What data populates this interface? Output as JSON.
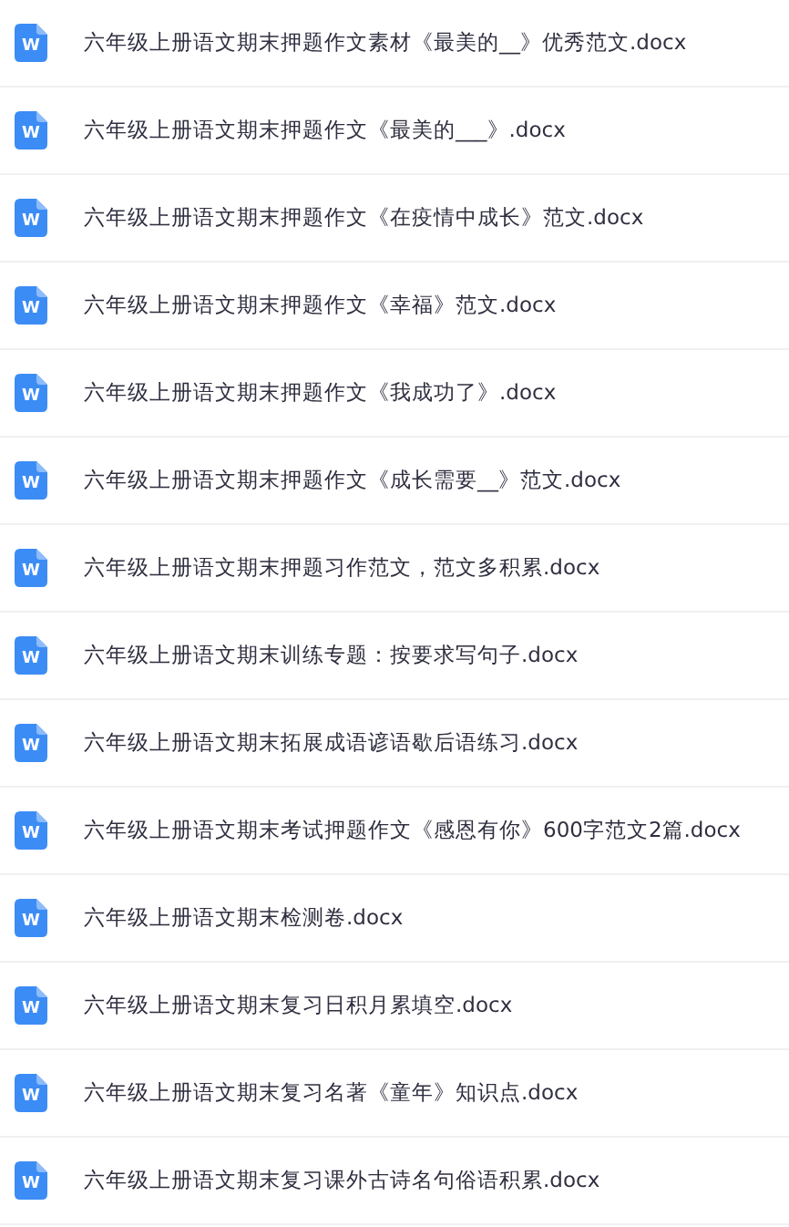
{
  "files": [
    {
      "name": "六年级上册语文期末押题作文素材《最美的__》优秀范文.docx",
      "badge": "W"
    },
    {
      "name": "六年级上册语文期末押题作文《最美的___》.docx",
      "badge": "W"
    },
    {
      "name": "六年级上册语文期末押题作文《在疫情中成长》范文.docx",
      "badge": "W"
    },
    {
      "name": "六年级上册语文期末押题作文《幸福》范文.docx",
      "badge": "W"
    },
    {
      "name": "六年级上册语文期末押题作文《我成功了》.docx",
      "badge": "W"
    },
    {
      "name": "六年级上册语文期末押题作文《成长需要__》范文.docx",
      "badge": "W"
    },
    {
      "name": "六年级上册语文期末押题习作范文，范文多积累.docx",
      "badge": "W"
    },
    {
      "name": "六年级上册语文期末训练专题：按要求写句子.docx",
      "badge": "W"
    },
    {
      "name": "六年级上册语文期末拓展成语谚语歇后语练习.docx",
      "badge": "W"
    },
    {
      "name": "六年级上册语文期末考试押题作文《感恩有你》600字范文2篇.docx",
      "badge": "W"
    },
    {
      "name": "六年级上册语文期末检测卷.docx",
      "badge": "W"
    },
    {
      "name": "六年级上册语文期末复习日积月累填空.docx",
      "badge": "W"
    },
    {
      "name": "六年级上册语文期末复习名著《童年》知识点.docx",
      "badge": "W"
    },
    {
      "name": "六年级上册语文期末复习课外古诗名句俗语积累.docx",
      "badge": "W"
    }
  ]
}
